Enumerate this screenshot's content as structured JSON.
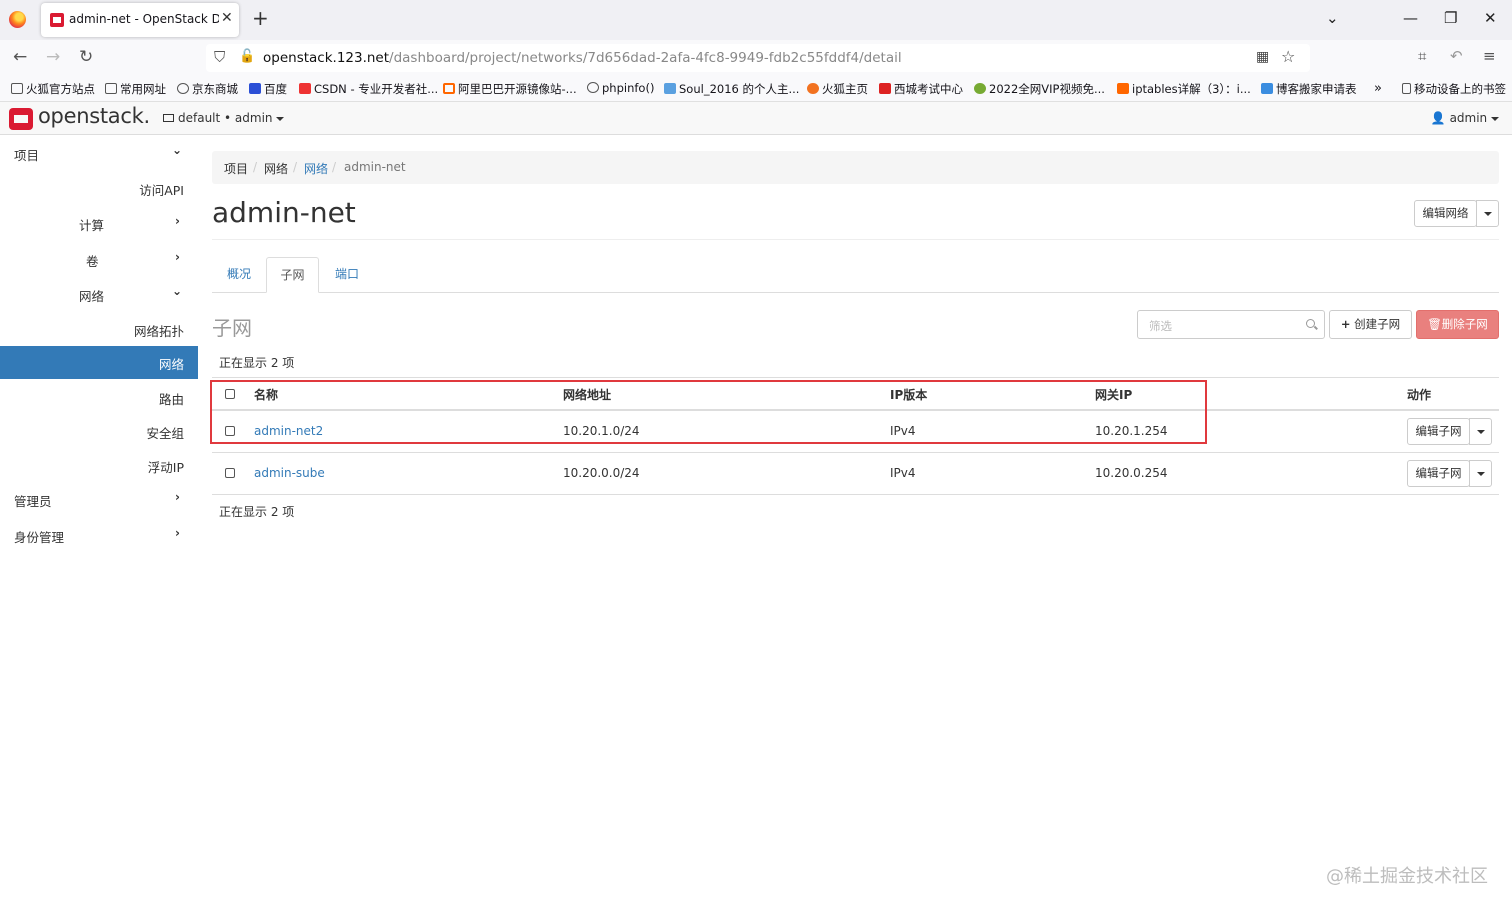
{
  "browser": {
    "tab_title": "admin-net - OpenStack Dashb",
    "url_host": "openstack.123.net",
    "url_path": "/dashboard/project/networks/7d656dad-2afa-4fc8-9949-fdb2c55fddf4/detail",
    "bookmarks": [
      "火狐官方站点",
      "常用网址",
      "京东商城",
      "百度",
      "CSDN - 专业开发者社...",
      "阿里巴巴开源镜像站-...",
      "phpinfo()",
      "Soul_2016 的个人主...",
      "火狐主页",
      "西城考试中心",
      "2022全网VIP视频免...",
      "iptables详解（3）：i...",
      "博客搬家申请表"
    ],
    "mobile_bookmarks": "移动设备上的书签"
  },
  "header": {
    "logo": "openstack.",
    "project": "default • admin",
    "user": "admin"
  },
  "sidebar": {
    "project": "项目",
    "api_access": "访问API",
    "compute": "计算",
    "volumes": "卷",
    "network": "网络",
    "network_topology": "网络拓扑",
    "networks": "网络",
    "routers": "路由",
    "security_groups": "安全组",
    "floating_ips": "浮动IP",
    "admin": "管理员",
    "identity": "身份管理"
  },
  "breadcrumb": [
    "项目",
    "网络",
    "网络",
    "admin-net"
  ],
  "page": {
    "title": "admin-net",
    "edit_network": "编辑网络"
  },
  "tabs": [
    "概况",
    "子网",
    "端口"
  ],
  "subnets": {
    "title": "子网",
    "filter_placeholder": "筛选",
    "create_label": "创建子网",
    "delete_label": "删除子网",
    "count_top": "正在显示 2 项",
    "count_bottom": "正在显示 2 项",
    "columns": [
      "名称",
      "网络地址",
      "IP版本",
      "网关IP",
      "动作"
    ],
    "rows": [
      {
        "name": "admin-net2",
        "cidr": "10.20.1.0/24",
        "ip_version": "IPv4",
        "gateway": "10.20.1.254",
        "action": "编辑子网"
      },
      {
        "name": "admin-sube",
        "cidr": "10.20.0.0/24",
        "ip_version": "IPv4",
        "gateway": "10.20.0.254",
        "action": "编辑子网"
      }
    ]
  },
  "watermark": "@稀土掘金技术社区",
  "colors": {
    "accent": "#337ab7",
    "danger": "#e9807e",
    "highlight_box": "#e0393e",
    "brand": "#da1a32"
  }
}
